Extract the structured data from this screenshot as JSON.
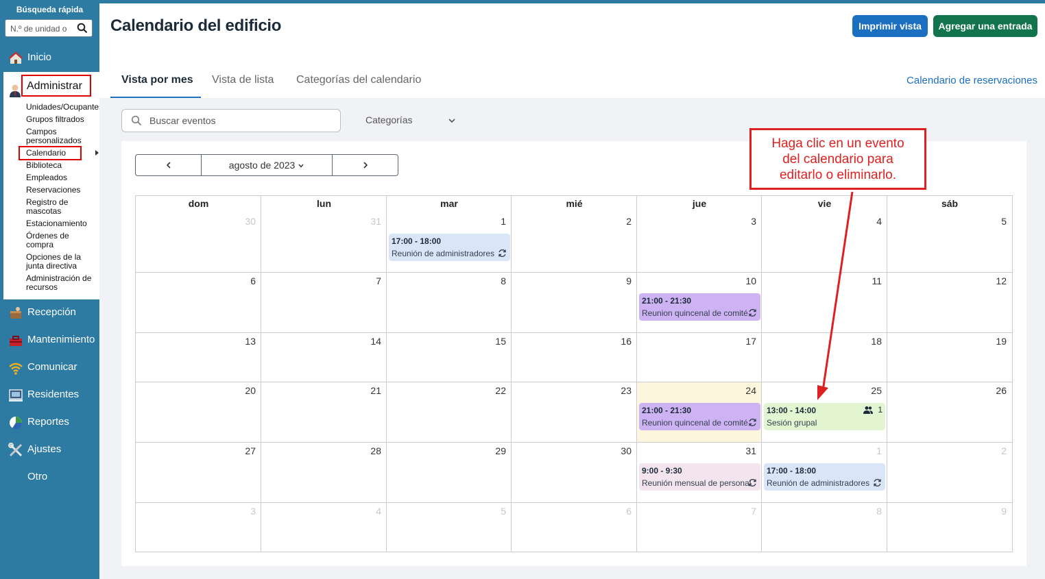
{
  "sidebar": {
    "quick_search_title": "Búsqueda rápida",
    "quick_search_placeholder": "N.º de unidad o",
    "items": [
      {
        "label": "Inicio"
      },
      {
        "label": "Administrar"
      },
      {
        "label": "Recepción"
      },
      {
        "label": "Mantenimiento"
      },
      {
        "label": "Comunicar"
      },
      {
        "label": "Residentes"
      },
      {
        "label": "Reportes"
      },
      {
        "label": "Ajustes"
      },
      {
        "label": "Otro"
      }
    ],
    "admin_subitems": [
      "Unidades/Ocupantes",
      "Grupos filtrados",
      "Campos personalizados",
      "Calendario",
      "Biblioteca",
      "Empleados",
      "Reservaciones",
      "Registro de mascotas",
      "Estacionamiento",
      "Órdenes de compra",
      "Opciones de la junta directiva",
      "Administración de recursos"
    ]
  },
  "header": {
    "title": "Calendario del edificio",
    "print_label": "Imprimir vista",
    "add_label": "Agregar una entrada"
  },
  "tabs": [
    {
      "label": "Vista por mes",
      "active": true
    },
    {
      "label": "Vista de lista",
      "active": false
    },
    {
      "label": "Categorías del calendario",
      "active": false
    }
  ],
  "reservations_link": "Calendario de reservaciones",
  "filters": {
    "search_placeholder": "Buscar eventos",
    "categories_label": "Categorías"
  },
  "month_nav": {
    "label": "agosto de 2023"
  },
  "calendar": {
    "days_of_week": [
      "dom",
      "lun",
      "mar",
      "mié",
      "jue",
      "vie",
      "sáb"
    ],
    "weeks": [
      [
        {
          "d": "30",
          "m": true
        },
        {
          "d": "31",
          "m": true
        },
        {
          "d": "1"
        },
        {
          "d": "2"
        },
        {
          "d": "3"
        },
        {
          "d": "4"
        },
        {
          "d": "5"
        }
      ],
      [
        {
          "d": "6"
        },
        {
          "d": "7"
        },
        {
          "d": "8"
        },
        {
          "d": "9"
        },
        {
          "d": "10"
        },
        {
          "d": "11"
        },
        {
          "d": "12"
        }
      ],
      [
        {
          "d": "13"
        },
        {
          "d": "14"
        },
        {
          "d": "15"
        },
        {
          "d": "16"
        },
        {
          "d": "17"
        },
        {
          "d": "18"
        },
        {
          "d": "19"
        }
      ],
      [
        {
          "d": "20"
        },
        {
          "d": "21"
        },
        {
          "d": "22"
        },
        {
          "d": "23"
        },
        {
          "d": "24",
          "today": true
        },
        {
          "d": "25"
        },
        {
          "d": "26"
        }
      ],
      [
        {
          "d": "27"
        },
        {
          "d": "28"
        },
        {
          "d": "29"
        },
        {
          "d": "30"
        },
        {
          "d": "31"
        },
        {
          "d": "1",
          "m": true
        },
        {
          "d": "2",
          "m": true
        }
      ],
      [
        {
          "d": "3",
          "m": true
        },
        {
          "d": "4",
          "m": true
        },
        {
          "d": "5",
          "m": true
        },
        {
          "d": "6",
          "m": true
        },
        {
          "d": "7",
          "m": true
        },
        {
          "d": "8",
          "m": true
        },
        {
          "d": "9",
          "m": true
        }
      ]
    ],
    "events": [
      {
        "week": 0,
        "day": 2,
        "time": "17:00 - 18:00",
        "name": "Reunión de administradores",
        "color": "blue",
        "recurring": true
      },
      {
        "week": 1,
        "day": 4,
        "time": "21:00 - 21:30",
        "name": "Reunion quincenal de comité",
        "color": "purple",
        "recurring": true
      },
      {
        "week": 3,
        "day": 4,
        "time": "21:00 - 21:30",
        "name": "Reunion quincenal de comité",
        "color": "purple",
        "recurring": true
      },
      {
        "week": 3,
        "day": 5,
        "time": "13:00 - 14:00",
        "name": "Sesión grupal",
        "color": "green",
        "attendees": "1"
      },
      {
        "week": 4,
        "day": 4,
        "time": "9:00 - 9:30",
        "name": "Reunión mensual de personal",
        "color": "pink",
        "recurring": true
      },
      {
        "week": 4,
        "day": 5,
        "time": "17:00 - 18:00",
        "name": "Reunión de administradores",
        "color": "blue",
        "recurring": true
      }
    ],
    "colors": {
      "today_bg": "#fdf6dc",
      "blue": "#dae6f8",
      "purple": "#cdb3f3",
      "pink": "#f4e4ee",
      "green": "#e4f6d1"
    }
  },
  "annotation": {
    "lines": [
      "Haga clic en un evento",
      "del calendario para",
      "editarlo o eliminarlo."
    ]
  }
}
